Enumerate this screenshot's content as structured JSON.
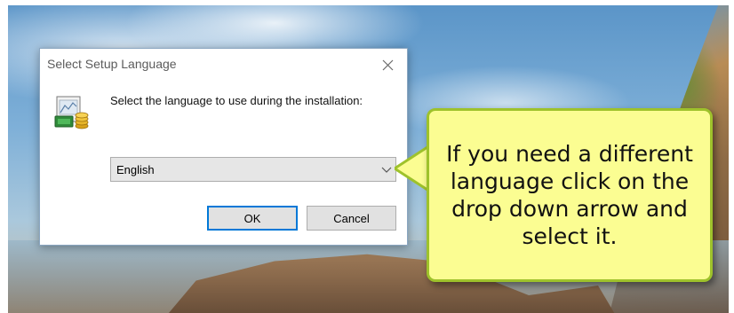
{
  "dialog": {
    "title": "Select Setup Language",
    "prompt": "Select the language to use during the installation:",
    "language_select": {
      "selected": "English"
    },
    "ok_label": "OK",
    "cancel_label": "Cancel"
  },
  "callout": {
    "text": "If you need a different language click on the drop down arrow and select it."
  },
  "icons": {
    "close": "close-icon",
    "dropdown": "chevron-down-icon",
    "app": "setup-installer-icon"
  },
  "colors": {
    "callout_fill": "#fbfd92",
    "callout_border": "#9ec22b",
    "ok_focus_border": "#0078d7"
  }
}
